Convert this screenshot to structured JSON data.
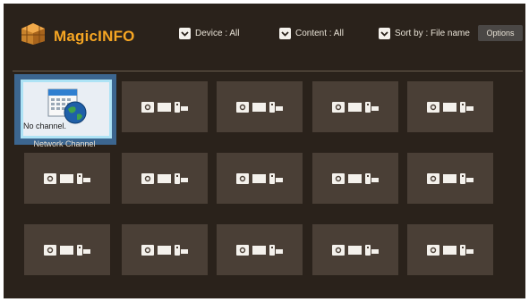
{
  "header": {
    "brand": "MagicINFO",
    "filters": [
      {
        "label": "Device : All"
      },
      {
        "label": "Content : All"
      },
      {
        "label": "Sort by : File name"
      }
    ],
    "options_label": "Options"
  },
  "selected_item": {
    "status": "No channel.",
    "label": "Network Channel"
  },
  "grid": {
    "rows": 3,
    "cols": 5
  },
  "colors": {
    "background": "#2a221b",
    "tile": "#4a3f36",
    "brand": "#f6a623",
    "selection": "#3c6690",
    "focus_border": "#aee3f5"
  },
  "icons": {
    "logo": "magicinfo-cube-logo",
    "filter": "chevron-down-icon",
    "tile": "device-placeholder-icon",
    "selected": "calendar-globe-icon"
  }
}
